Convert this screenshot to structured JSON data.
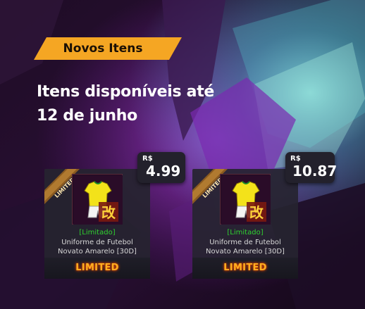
{
  "banner": {
    "badge_label": "Novos Itens",
    "headline_line1": "Itens disponíveis até",
    "headline_line2": "12 de junho"
  },
  "colors": {
    "badge_fill": "#f5a623",
    "limited_green": "#2fd12f",
    "limited_orange": "#ffb020",
    "card_bg": "#262430"
  },
  "items": [
    {
      "ribbon_text": "LIMITED",
      "tag": "[Limitado]",
      "name_line1": "Uniforme de Futebol",
      "name_line2": "Novato Amarelo [30D]",
      "footer": "LIMITED",
      "currency": "R$",
      "price": "4.99",
      "icon": "yellow-jersey-icon",
      "mark": "改"
    },
    {
      "ribbon_text": "LIMITED",
      "tag": "[Limitado]",
      "name_line1": "Uniforme de Futebol",
      "name_line2": "Novato Amarelo [30D]",
      "footer": "LIMITED",
      "currency": "R$",
      "price": "10.87",
      "icon": "yellow-jersey-icon",
      "mark": "改"
    }
  ]
}
